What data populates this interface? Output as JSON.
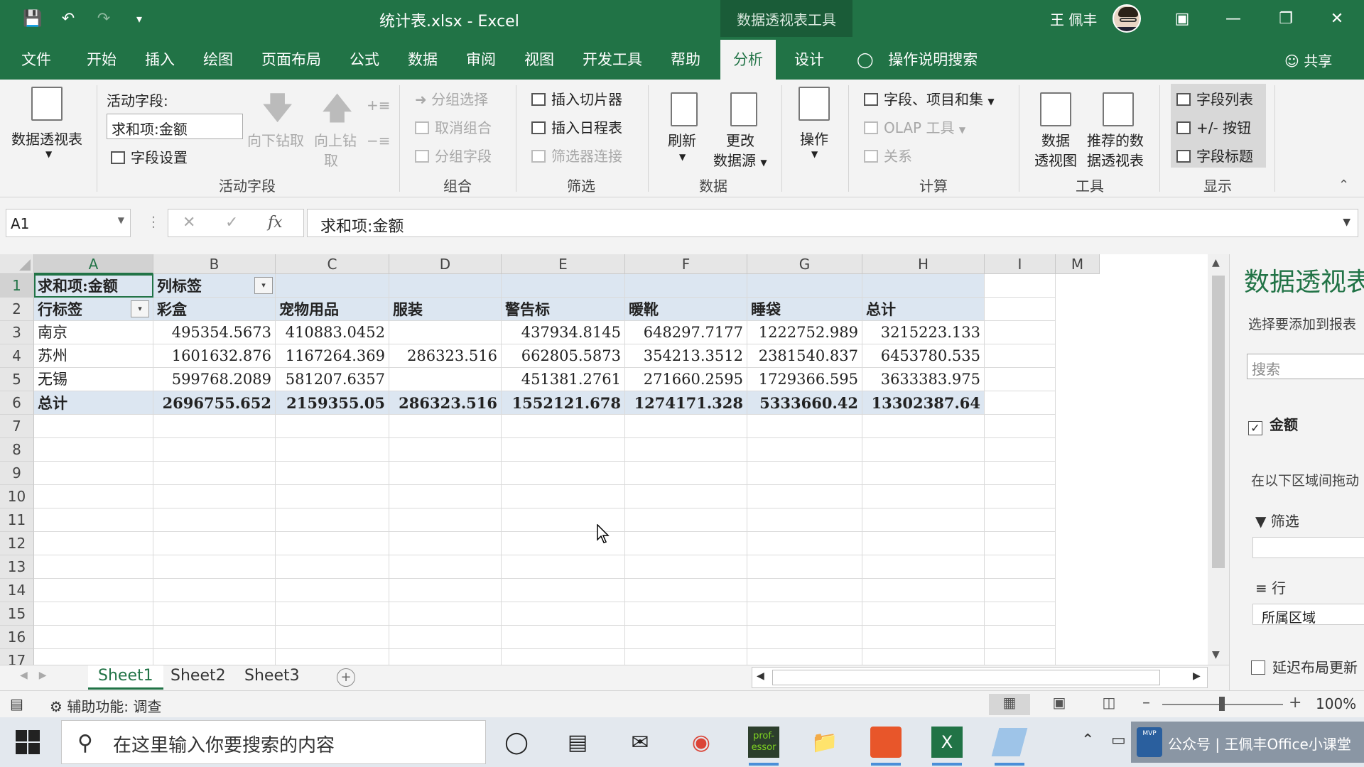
{
  "titlebar": {
    "doc_title": "统计表.xlsx  -  Excel",
    "context_tab": "数据透视表工具",
    "user_name": "王 佩丰"
  },
  "tabs": [
    {
      "label": "文件"
    },
    {
      "label": "开始"
    },
    {
      "label": "插入"
    },
    {
      "label": "绘图"
    },
    {
      "label": "页面布局"
    },
    {
      "label": "公式"
    },
    {
      "label": "数据"
    },
    {
      "label": "审阅"
    },
    {
      "label": "视图"
    },
    {
      "label": "开发工具"
    },
    {
      "label": "帮助"
    },
    {
      "label": "分析"
    },
    {
      "label": "设计"
    }
  ],
  "tell_me": "操作说明搜索",
  "share": "共享",
  "ribbon": {
    "pivot_table": "数据透视表",
    "active_field_label": "活动字段:",
    "active_field_value": "求和项:金额",
    "field_settings": "字段设置",
    "drill_down": "向下钻取",
    "drill_up_1": "向上钻",
    "drill_up_2": "取",
    "group_active_field": "活动字段",
    "group_selection": "分组选择",
    "ungroup": "取消组合",
    "group_field": "分组字段",
    "group_group": "组合",
    "insert_slicer": "插入切片器",
    "insert_timeline": "插入日程表",
    "filter_connections": "筛选器连接",
    "group_filter": "筛选",
    "refresh": "刷新",
    "change_source_1": "更改",
    "change_source_2": "数据源",
    "group_data": "数据",
    "actions": "操作",
    "fields_items_sets": "字段、项目和集",
    "olap_tools": "OLAP 工具",
    "relationships": "关系",
    "group_calc": "计算",
    "pivot_chart_1": "数据",
    "pivot_chart_2": "透视图",
    "recommended_1": "推荐的数",
    "recommended_2": "据透视表",
    "group_tools": "工具",
    "field_list": "字段列表",
    "buttons": "+/- 按钮",
    "field_headers": "字段标题",
    "group_show": "显示"
  },
  "formula_bar": {
    "name_box": "A1",
    "fx": "fx",
    "content": "求和项:金额"
  },
  "grid": {
    "columns": [
      "A",
      "B",
      "C",
      "D",
      "E",
      "F",
      "G",
      "H",
      "I",
      "M"
    ],
    "row_numbers": [
      "1",
      "2",
      "3",
      "4",
      "5",
      "6",
      "7",
      "8",
      "9",
      "10",
      "11",
      "12",
      "13",
      "14",
      "15",
      "16",
      "17"
    ],
    "a1": "求和项:金额",
    "b1": "列标签",
    "header_row": [
      "行标签",
      "彩盒",
      "宠物用品",
      "服装",
      "警告标",
      "暖靴",
      "睡袋",
      "总计"
    ],
    "data_rows": [
      [
        "南京",
        "495354.5673",
        "410883.0452",
        "",
        "437934.8145",
        "648297.7177",
        "1222752.989",
        "3215223.133"
      ],
      [
        "苏州",
        "1601632.876",
        "1167264.369",
        "286323.516",
        "662805.5873",
        "354213.3512",
        "2381540.837",
        "6453780.535"
      ],
      [
        "无锡",
        "599768.2089",
        "581207.6357",
        "",
        "451381.2761",
        "271660.2595",
        "1729366.595",
        "3633383.975"
      ]
    ],
    "total_row": [
      "总计",
      "2696755.652",
      "2159355.05",
      "286323.516",
      "1552121.678",
      "1274171.328",
      "5333660.42",
      "13302387.64"
    ]
  },
  "sheets": [
    {
      "label": "Sheet1"
    },
    {
      "label": "Sheet2"
    },
    {
      "label": "Sheet3"
    }
  ],
  "status": {
    "accessibility": "辅助功能: 调查",
    "zoom": "100%"
  },
  "pane": {
    "title": "数据透视表",
    "subtitle": "选择要添加到报表",
    "search_placeholder": "搜索",
    "field_amount": "金额",
    "drag_hint": "在以下区域间拖动",
    "area_filter": "筛选",
    "area_rows": "行",
    "rows_item": "所属区域",
    "defer_update": "延迟布局更新"
  },
  "taskbar": {
    "search_placeholder": "在这里输入你要搜索的内容",
    "watermark": "公众号 | 王佩丰Office小课堂",
    "professor_label": "prof-essor"
  },
  "colors": {
    "excel_green": "#217346",
    "pivot_band": "#dce6f1"
  }
}
